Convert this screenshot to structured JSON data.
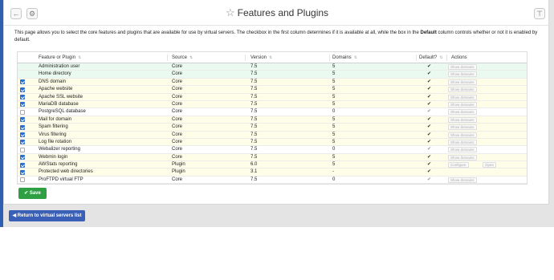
{
  "titlebar": {
    "left_buttons": [
      {
        "label": "←",
        "icon": "arrow-left-icon"
      },
      {
        "label": "⚙",
        "icon": "gear-icon"
      }
    ],
    "title": "Features and Plugins",
    "right_button": {
      "label": "⊤",
      "icon": "filter-icon"
    }
  },
  "intro": {
    "before_bold_1": "This page allows you to select the core features and plugins that are available for use by virtual servers. The checkbox in the first column determines if it is available at all, while the box in the ",
    "bold_1": "Default",
    "after_bold_1": " column controls whether or not it is enabled by default."
  },
  "table": {
    "headers": [
      "Feature or Plugin",
      "Source",
      "Version",
      "Domains",
      "Default?",
      "Actions"
    ],
    "rows": [
      {
        "name": "Administration user",
        "source": "Core",
        "version": "7.5",
        "domains": "5",
        "default": "✔",
        "checked": null,
        "style": "green",
        "actions": [
          "Show domains"
        ]
      },
      {
        "name": "Home directory",
        "source": "Core",
        "version": "7.5",
        "domains": "5",
        "default": "✔",
        "checked": null,
        "style": "green",
        "actions": [
          "Show domains"
        ]
      },
      {
        "name": "DNS domain",
        "source": "Core",
        "version": "7.5",
        "domains": "5",
        "default": "✔",
        "checked": true,
        "style": "yellow",
        "actions": [
          "Show domains"
        ]
      },
      {
        "name": "Apache website",
        "source": "Core",
        "version": "7.5",
        "domains": "5",
        "default": "✔",
        "checked": true,
        "style": "yellow",
        "actions": [
          "Show domains"
        ]
      },
      {
        "name": "Apache SSL website",
        "source": "Core",
        "version": "7.5",
        "domains": "5",
        "default": "✔",
        "checked": true,
        "style": "yellow",
        "actions": [
          "Show domains"
        ]
      },
      {
        "name": "MariaDB database",
        "source": "Core",
        "version": "7.5",
        "domains": "5",
        "default": "✔",
        "checked": true,
        "style": "yellow",
        "actions": [
          "Show domains"
        ]
      },
      {
        "name": "PostgreSQL database",
        "source": "Core",
        "version": "7.5",
        "domains": "0",
        "default": "✔",
        "checked": false,
        "style": "white",
        "actions": [
          "Show domains"
        ]
      },
      {
        "name": "Mail for domain",
        "source": "Core",
        "version": "7.5",
        "domains": "5",
        "default": "✔",
        "checked": true,
        "style": "yellow",
        "actions": [
          "Show domains"
        ]
      },
      {
        "name": "Spam filtering",
        "source": "Core",
        "version": "7.5",
        "domains": "5",
        "default": "✔",
        "checked": true,
        "style": "yellow",
        "actions": [
          "Show domains"
        ]
      },
      {
        "name": "Virus filtering",
        "source": "Core",
        "version": "7.5",
        "domains": "5",
        "default": "✔",
        "checked": true,
        "style": "yellow",
        "actions": [
          "Show domains"
        ]
      },
      {
        "name": "Log file rotation",
        "source": "Core",
        "version": "7.5",
        "domains": "5",
        "default": "✔",
        "checked": true,
        "style": "yellow",
        "actions": [
          "Show domains"
        ]
      },
      {
        "name": "Webalizer reporting",
        "source": "Core",
        "version": "7.5",
        "domains": "0",
        "default": "✔",
        "checked": false,
        "style": "white",
        "actions": [
          "Show domains"
        ]
      },
      {
        "name": "Webmin login",
        "source": "Core",
        "version": "7.5",
        "domains": "5",
        "default": "✔",
        "checked": true,
        "style": "yellow",
        "actions": [
          "Show domains"
        ]
      },
      {
        "name": "AWStats reporting",
        "source": "Plugin",
        "version": "6.0",
        "domains": "5",
        "default": "✔",
        "checked": true,
        "style": "yellow",
        "actions": [
          "Configure",
          "Open"
        ]
      },
      {
        "name": "Protected web directories",
        "source": "Plugin",
        "version": "3.1",
        "domains": "-",
        "default": "✔",
        "checked": true,
        "style": "yellow",
        "actions": []
      },
      {
        "name": "ProFTPD virtual FTP",
        "source": "Core",
        "version": "7.5",
        "domains": "0",
        "default": "✔",
        "checked": false,
        "style": "white",
        "actions": [
          "Show domains"
        ]
      }
    ]
  },
  "buttons": {
    "save": "Save",
    "back": "Return to virtual servers list"
  },
  "colors": {
    "accent_blue": "#2f5fb3",
    "save_green": "#2ea043",
    "row_green": "#eafaf0",
    "row_yellow": "#fefde8"
  }
}
